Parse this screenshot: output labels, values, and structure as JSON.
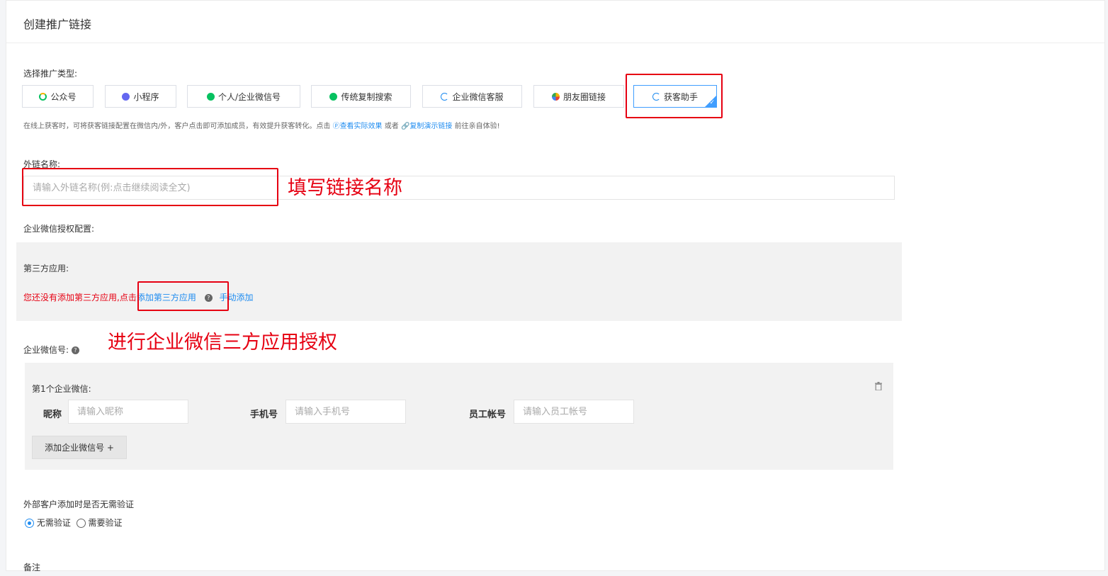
{
  "page": {
    "title": "创建推广链接"
  },
  "promo_type": {
    "label": "选择推广类型:",
    "buttons": [
      {
        "label": "公众号",
        "icon": "wechat-official-icon"
      },
      {
        "label": "小程序",
        "icon": "mini-program-icon"
      },
      {
        "label": "个人/企业微信号",
        "icon": "wechat-icon"
      },
      {
        "label": "传统复制搜索",
        "icon": "wechat-icon"
      },
      {
        "label": "企业微信客服",
        "icon": "wecom-icon"
      },
      {
        "label": "朋友圈链接",
        "icon": "moments-icon"
      },
      {
        "label": "获客助手",
        "icon": "wecom-icon",
        "selected": true
      }
    ],
    "hint_text": "在线上获客时，可将获客链接配置在微信内/外，客户点击即可添加成员，有效提升获客转化。点击",
    "hint_link1": "查看实际效果",
    "hint_or": "或者",
    "hint_link2": "复制演示链接",
    "hint_tail": "前往亲自体验!"
  },
  "link_name": {
    "label": "外链名称:",
    "placeholder": "请输入外链名称(例:点击继续阅读全文)",
    "annotation": "填写链接名称"
  },
  "wecom_auth": {
    "label": "企业微信授权配置:",
    "third_party_label": "第三方应用:",
    "warning": "您还没有添加第三方应用,",
    "click_text": "点击",
    "add_link": "添加第三方应用",
    "manual_link": "手动添加",
    "annotation": "进行企业微信三方应用授权"
  },
  "wecom_accounts": {
    "label": "企业微信号:",
    "item_title": "第1个企业微信:",
    "nickname_label": "昵称",
    "nickname_placeholder": "请输入昵称",
    "phone_label": "手机号",
    "phone_placeholder": "请输入手机号",
    "staff_label": "员工帐号",
    "staff_placeholder": "请输入员工帐号",
    "add_button": "添加企业微信号 +"
  },
  "verification": {
    "label": "外部客户添加时是否无需验证",
    "option_no": "无需验证",
    "option_yes": "需要验证"
  },
  "remark": {
    "label": "备注"
  },
  "colors": {
    "accent": "#1f8cf0",
    "annotation_red": "#e60012",
    "wechat_green": "#07c160"
  }
}
